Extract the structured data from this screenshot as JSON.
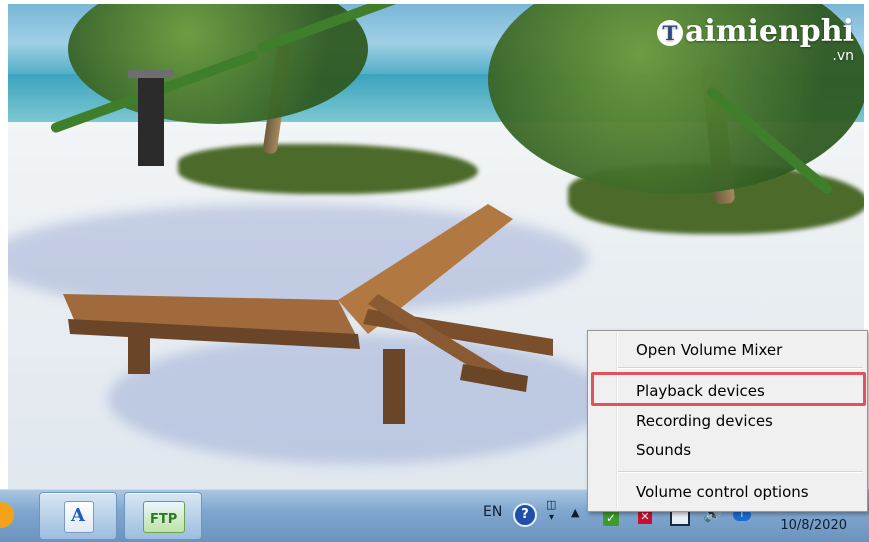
{
  "watermark": {
    "brand": "aimienphi",
    "brand_initial": "T",
    "domain": ".vn"
  },
  "context_menu": {
    "items": [
      {
        "label": "Open Volume Mixer"
      },
      {
        "label": "Playback devices"
      },
      {
        "label": "Recording devices"
      },
      {
        "label": "Sounds"
      },
      {
        "label": "Volume control options"
      }
    ],
    "highlighted_item": "Playback devices",
    "highlight_color": "#e2525c"
  },
  "taskbar": {
    "pinned": [
      {
        "icon": "orange-app-icon"
      },
      {
        "icon": "document-app-icon",
        "glyph": "A"
      },
      {
        "icon": "cuteftp-icon",
        "glyph": "FTP"
      }
    ],
    "tray": {
      "language": "EN",
      "help_glyph": "?",
      "date": "10/8/2020"
    }
  }
}
